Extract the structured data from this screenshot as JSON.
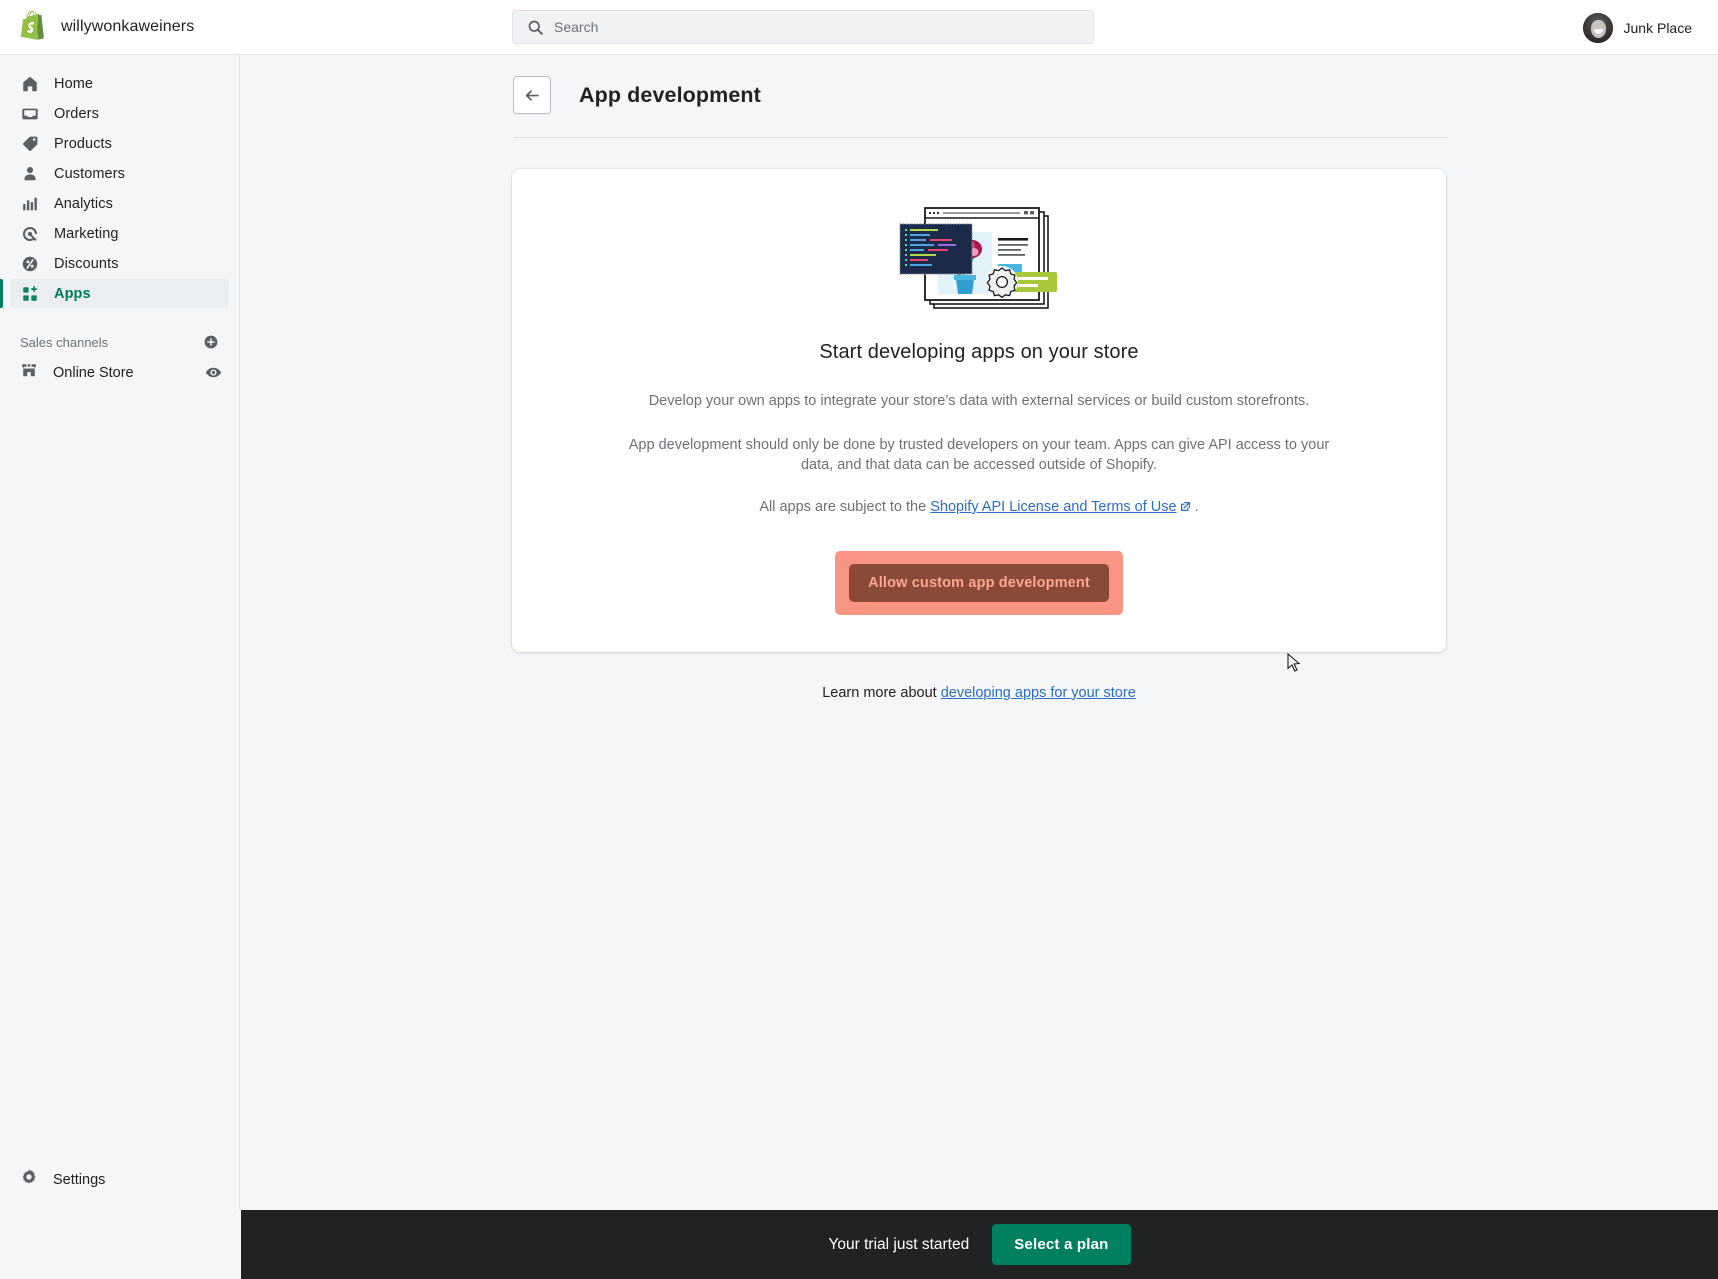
{
  "topbar": {
    "brand_name": "willywonkaweiners",
    "logo_icon": "shopify-bag-icon",
    "search": {
      "icon": "search-icon",
      "placeholder": "Search",
      "value": ""
    },
    "user": {
      "name": "Junk Place",
      "avatar_icon": "user-avatar-photo"
    }
  },
  "sidebar": {
    "items": [
      {
        "label": "Home",
        "icon": "home-icon",
        "active": false
      },
      {
        "label": "Orders",
        "icon": "orders-inbox-icon",
        "active": false
      },
      {
        "label": "Products",
        "icon": "product-tag-icon",
        "active": false
      },
      {
        "label": "Customers",
        "icon": "customer-person-icon",
        "active": false
      },
      {
        "label": "Analytics",
        "icon": "analytics-bars-icon",
        "active": false
      },
      {
        "label": "Marketing",
        "icon": "marketing-target-icon",
        "active": false
      },
      {
        "label": "Discounts",
        "icon": "discount-percent-icon",
        "active": false
      },
      {
        "label": "Apps",
        "icon": "apps-grid-plus-icon",
        "active": true
      }
    ],
    "sales_channels": {
      "title": "Sales channels",
      "add_icon": "plus-circle-icon",
      "channels": [
        {
          "label": "Online Store",
          "icon": "storefront-icon",
          "action_icon": "eye-icon"
        }
      ]
    },
    "settings": {
      "label": "Settings",
      "icon": "gear-icon"
    }
  },
  "main": {
    "back_icon": "arrow-left-icon",
    "page_title": "App development",
    "card": {
      "illustration": "app-development-illustration",
      "heading": "Start developing apps on your store",
      "paragraph_1": "Develop your own apps to integrate your store’s data with external services or build custom storefronts.",
      "paragraph_2": "App development should only be done by trusted developers on your team. Apps can give API access to your data, and that data can be accessed outside of Shopify.",
      "terms_prefix": "All apps are subject to the ",
      "terms_link": "Shopify API License and Terms of Use",
      "terms_link_icon": "external-link-icon",
      "terms_suffix": " .",
      "primary_button": "Allow custom app development",
      "primary_button_highlighted": true
    },
    "learn_more_prefix": "Learn more about ",
    "learn_more_link": "developing apps for your store",
    "cursor_icon": "mouse-pointer-icon"
  },
  "trial_bar": {
    "message": "Your trial just started",
    "cta_label": "Select a plan"
  },
  "colors": {
    "accent_green": "#008060",
    "active_nav_text": "#007b5c",
    "link_blue": "#2c6ecb",
    "highlight_salmon": "#fa9584",
    "button_brown": "#8a4a37",
    "button_text_salmon": "#fca695",
    "dark_bar": "#202223",
    "page_bg": "#f4f6f8"
  }
}
